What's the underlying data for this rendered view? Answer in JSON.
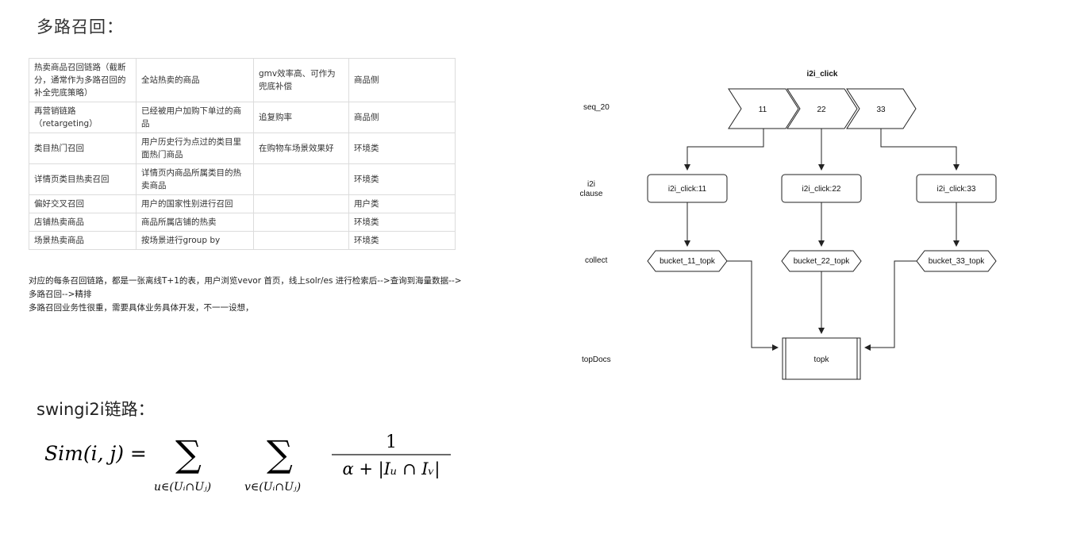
{
  "heading_multi": "多路召回：",
  "table": {
    "rows": [
      [
        "热卖商品召回链路（截断分，通常作为多路召回的补全兜底策略）",
        "全站热卖的商品",
        "gmv效率高、可作为兜底补偿",
        "商品侧"
      ],
      [
        "再营销链路（retargeting）",
        "已经被用户加购下单过的商品",
        "追复购率",
        "商品侧"
      ],
      [
        "类目热门召回",
        "用户历史行为点过的类目里面热门商品",
        "在购物车场景效果好",
        "环境类"
      ],
      [
        "详情页类目热卖召回",
        "详情页内商品所属类目的热卖商品",
        "",
        "环境类"
      ],
      [
        "偏好交叉召回",
        "用户的国家性别进行召回",
        "",
        "用户类"
      ],
      [
        "店铺热卖商品",
        "商品所属店铺的热卖",
        "",
        "环境类"
      ],
      [
        "场景热卖商品",
        "按场景进行group by",
        "",
        "环境类"
      ]
    ]
  },
  "notes": [
    "对应的每条召回链路，都是一张离线T+1的表，用户浏览vevor 首页，线上solr/es 进行检索后-->查询到海量数据-->",
    "多路召回-->精排",
    "多路召回业务性很重，需要具体业务具体开发，不一一设想，"
  ],
  "heading_swing": "swingi2i链路：",
  "formula": {
    "lhs": "Sim(i, j) =",
    "sum1_sub": "u∈(Uᵢ∩Uⱼ)",
    "sum2_sub": "v∈(Uᵢ∩Uⱼ)",
    "numerator": "1",
    "denominator": "α + |Iᵤ ∩ Iᵥ|"
  },
  "diagram": {
    "title": "i2i_click",
    "row_labels": [
      "seq_20",
      "i2i",
      "clause",
      "collect",
      "topDocs"
    ],
    "seq": [
      "11",
      "22",
      "33"
    ],
    "clauses": [
      "i2i_click:11",
      "i2i_click:22",
      "i2i_click:33"
    ],
    "buckets": [
      "bucket_11_topk",
      "bucket_22_topk",
      "bucket_33_topk"
    ],
    "topk": "topk"
  }
}
